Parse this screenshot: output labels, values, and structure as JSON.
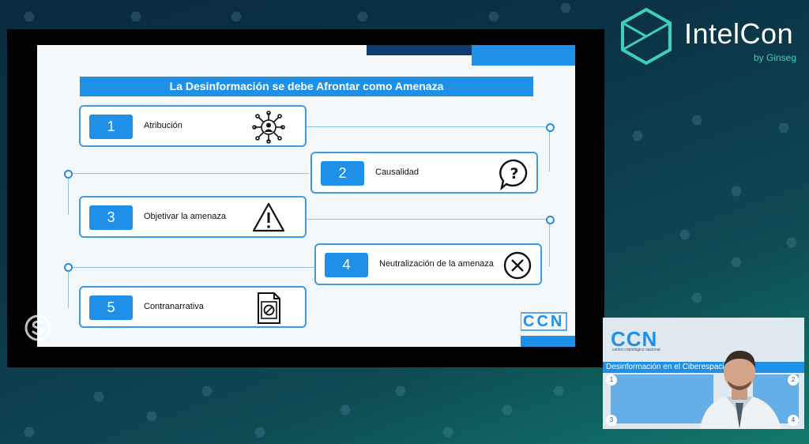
{
  "brand": {
    "name": "IntelCon",
    "sub": "by Ginseg",
    "accent": "#3fd1b5"
  },
  "slide": {
    "title": "La Desinformación se debe Afrontar como Amenaza",
    "accent": "#1e90e8",
    "steps": [
      {
        "num": "1",
        "label": "Atribución",
        "icon": "network-person-icon"
      },
      {
        "num": "2",
        "label": "Causalidad",
        "icon": "question-bubble-icon"
      },
      {
        "num": "3",
        "label": "Objetivar la amenaza",
        "icon": "warning-triangle-icon"
      },
      {
        "num": "4",
        "label": "Neutralización de la amenaza",
        "icon": "circle-x-icon"
      },
      {
        "num": "5",
        "label": "Contranarrativa",
        "icon": "blocked-document-icon"
      }
    ],
    "logo": "CCN"
  },
  "pip": {
    "logo": "CCN",
    "subtitle": "centro criptológico nacional",
    "band": "Desinformación en el Ciberespacio",
    "nums": [
      "1",
      "2",
      "3",
      "4"
    ]
  }
}
